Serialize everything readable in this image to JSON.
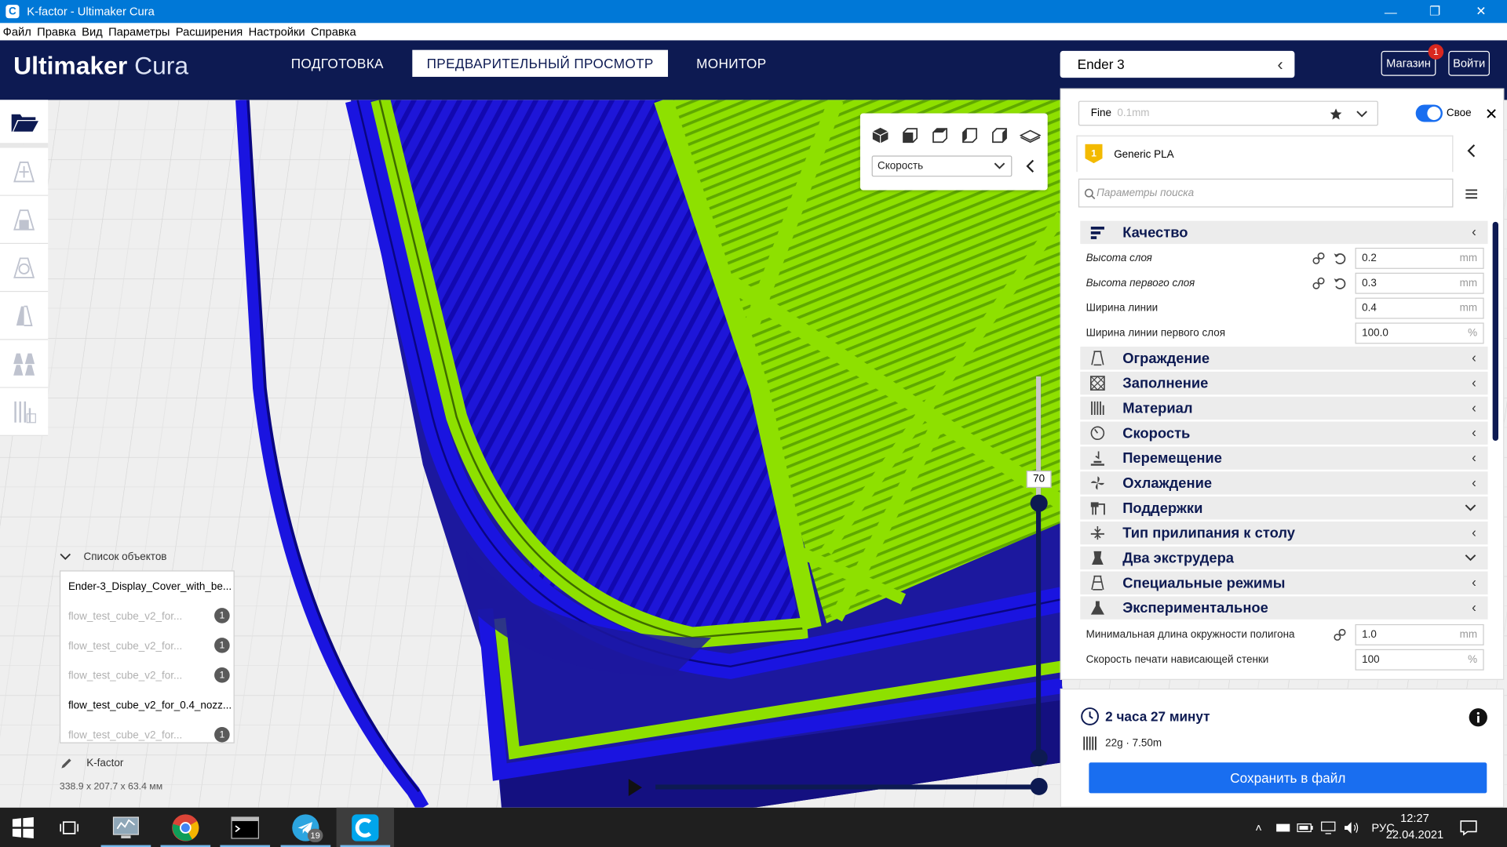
{
  "window": {
    "title": "K-factor - Ultimaker Cura",
    "app_icon": "C"
  },
  "menu": [
    "Файл",
    "Правка",
    "Вид",
    "Параметры",
    "Расширения",
    "Настройки",
    "Справка"
  ],
  "header": {
    "logo_bold": "Ultimaker",
    "logo_light": "Cura",
    "tabs": [
      {
        "label": "ПОДГОТОВКА",
        "active": false
      },
      {
        "label": "ПРЕДВАРИТЕЛЬНЫЙ ПРОСМОТР",
        "active": true
      },
      {
        "label": "МОНИТОР",
        "active": false
      }
    ],
    "printer": "Ender 3",
    "marketplace_label": "Магазин",
    "marketplace_badge": "1",
    "signin_label": "Войти"
  },
  "viewpanel": {
    "color_scheme": "Скорость"
  },
  "layer": {
    "current": "70"
  },
  "objects": {
    "header": "Список объектов",
    "items": [
      {
        "name": "Ender-3_Display_Cover_with_be...",
        "dim": false,
        "extruder": ""
      },
      {
        "name": "flow_test_cube_v2_for...",
        "dim": true,
        "extruder": "1"
      },
      {
        "name": "flow_test_cube_v2_for...",
        "dim": true,
        "extruder": "1"
      },
      {
        "name": "flow_test_cube_v2_for...",
        "dim": true,
        "extruder": "1"
      },
      {
        "name": "flow_test_cube_v2_for_0.4_nozz...",
        "dim": false,
        "extruder": ""
      },
      {
        "name": "flow_test_cube_v2_for...",
        "dim": true,
        "extruder": "1"
      }
    ],
    "project_name": "K-factor",
    "dimensions": "338.9 x 207.7 x 63.4 мм"
  },
  "settings": {
    "profile": "Fine",
    "profile_sub": "0.1mm",
    "custom_label": "Свое",
    "extruder_number": "1",
    "material": "Generic PLA",
    "search_placeholder": "Параметры поиска",
    "quality_category": "Качество",
    "quality_rows": [
      {
        "label": "Высота слоя",
        "value": "0.2",
        "unit": "mm",
        "italic": true,
        "link": true,
        "reset": true
      },
      {
        "label": "Высота первого слоя",
        "value": "0.3",
        "unit": "mm",
        "italic": true,
        "link": true,
        "reset": true
      },
      {
        "label": "Ширина линии",
        "value": "0.4",
        "unit": "mm",
        "italic": false,
        "link": false,
        "reset": false
      },
      {
        "label": "Ширина линии первого слоя",
        "value": "100.0",
        "unit": "%",
        "italic": false,
        "link": false,
        "reset": false
      }
    ],
    "categories": [
      {
        "label": "Ограждение",
        "icon": "shell-icon",
        "expanded": false
      },
      {
        "label": "Заполнение",
        "icon": "infill-icon",
        "expanded": false
      },
      {
        "label": "Материал",
        "icon": "material-icon",
        "expanded": false
      },
      {
        "label": "Скорость",
        "icon": "speed-icon",
        "expanded": false
      },
      {
        "label": "Перемещение",
        "icon": "travel-icon",
        "expanded": false
      },
      {
        "label": "Охлаждение",
        "icon": "cooling-icon",
        "expanded": false
      },
      {
        "label": "Поддержки",
        "icon": "support-icon",
        "expanded": true
      },
      {
        "label": "Тип прилипания к столу",
        "icon": "adhesion-icon",
        "expanded": false
      },
      {
        "label": "Два экструдера",
        "icon": "dual-extruder-icon",
        "expanded": true
      },
      {
        "label": "Специальные режимы",
        "icon": "special-modes-icon",
        "expanded": false
      },
      {
        "label": "Экспериментальное",
        "icon": "experimental-icon",
        "expanded": false
      }
    ],
    "experimental_rows": [
      {
        "label": "Минимальная длина окружности полигона",
        "value": "1.0",
        "unit": "mm",
        "link": true
      },
      {
        "label": "Скорость печати нависающей стенки",
        "value": "100",
        "unit": "%",
        "link": false
      }
    ]
  },
  "summary": {
    "time": "2 часа 27 минут",
    "material": "22g · 7.50m",
    "save_label": "Сохранить в файл"
  },
  "taskbar": {
    "telegram_badge": "19",
    "language": "РУС",
    "time": "12:27",
    "date": "22.04.2021"
  },
  "colors": {
    "header": "#0d1a52",
    "accent": "#196ef0",
    "wall_blue": "#1a14e0",
    "infill_green": "#8ee000",
    "dark_shade": "#1a1a8a"
  }
}
